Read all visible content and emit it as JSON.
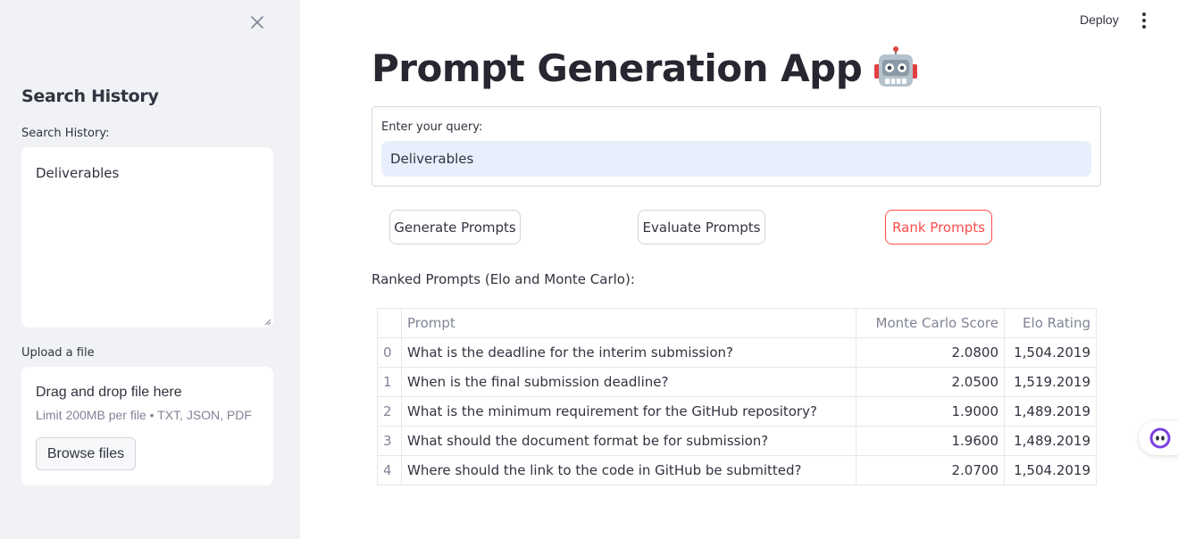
{
  "sidebar": {
    "title": "Search History",
    "history_label": "Search History:",
    "history_value": "Deliverables",
    "upload_label": "Upload a file",
    "dropzone_title": "Drag and drop file here",
    "dropzone_limit": "Limit 200MB per file • TXT, JSON, PDF",
    "browse_label": "Browse files"
  },
  "header": {
    "deploy_label": "Deploy"
  },
  "main": {
    "title": "Prompt Generation App",
    "query_label": "Enter your query:",
    "query_value": "Deliverables",
    "buttons": {
      "generate": "Generate Prompts",
      "evaluate": "Evaluate Prompts",
      "rank": "Rank Prompts"
    },
    "ranked_label": "Ranked Prompts (Elo and Monte Carlo):",
    "table": {
      "headers": [
        "",
        "Prompt",
        "Monte Carlo Score",
        "Elo Rating"
      ],
      "rows": [
        {
          "index": "0",
          "prompt": "What is the deadline for the interim submission?",
          "mc": "2.0800",
          "elo": "1,504.2019"
        },
        {
          "index": "1",
          "prompt": "When is the final submission deadline?",
          "mc": "2.0500",
          "elo": "1,519.2019"
        },
        {
          "index": "2",
          "prompt": "What is the minimum requirement for the GitHub repository?",
          "mc": "1.9000",
          "elo": "1,489.2019"
        },
        {
          "index": "3",
          "prompt": "What should the document format be for submission?",
          "mc": "1.9600",
          "elo": "1,489.2019"
        },
        {
          "index": "4",
          "prompt": "Where should the link to the code in GitHub be submitted?",
          "mc": "2.0700",
          "elo": "1,504.2019"
        }
      ]
    }
  },
  "colors": {
    "sidebar_bg": "#f0f2f6",
    "accent": "#ff4b4b",
    "input_bg": "#e8eefb",
    "text": "#31333f",
    "muted": "#808495"
  },
  "icons": {
    "close": "close-icon",
    "robot": "robot-icon",
    "kebab": "kebab-menu-icon",
    "chat": "chat-assistant-icon"
  }
}
